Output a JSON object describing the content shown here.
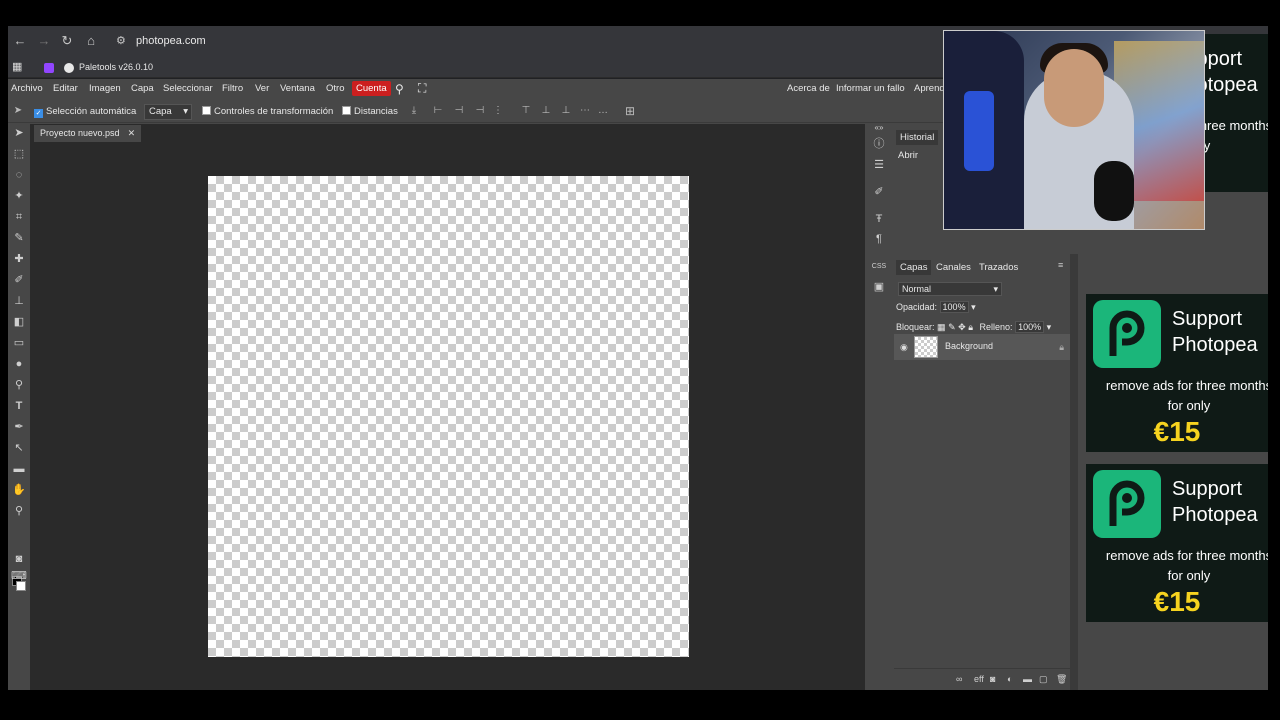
{
  "browser": {
    "url": "photopea.com",
    "bookmark": "Paletools v26.0.10"
  },
  "menu": {
    "items": [
      "Archivo",
      "Editar",
      "Imagen",
      "Capa",
      "Seleccionar",
      "Filtro",
      "Ver",
      "Ventana",
      "Otro"
    ],
    "account": "Cuenta",
    "right": [
      "Acerca de",
      "Informar un fallo",
      "Aprend"
    ]
  },
  "options": {
    "auto_select": "Selección automática",
    "target": "Capa",
    "transform_controls": "Controles de transformación",
    "distances": "Distancias"
  },
  "document": {
    "tab": "Proyecto nuevo.psd"
  },
  "history": {
    "tab": "Historial",
    "items": [
      "Abrir"
    ]
  },
  "layers": {
    "tabs": [
      "Capas",
      "Canales",
      "Trazados"
    ],
    "blend_mode": "Normal",
    "opacity_label": "Opacidad:",
    "opacity_value": "100%",
    "lock_label": "Bloquear:",
    "fill_label": "Relleno:",
    "fill_value": "100%",
    "layer_name": "Background"
  },
  "ads": {
    "title_line1": "Support",
    "title_line2": "Photopea",
    "subtitle_line1": "remove ads for three months",
    "subtitle_line2": "for only",
    "price": "€15",
    "brand_color": "#1bb67a",
    "price_color": "#f6d31f"
  },
  "colors": {
    "account_button": "#cc1f1f",
    "app_bg": "#474747",
    "workspace_bg": "#2a2a2a"
  }
}
